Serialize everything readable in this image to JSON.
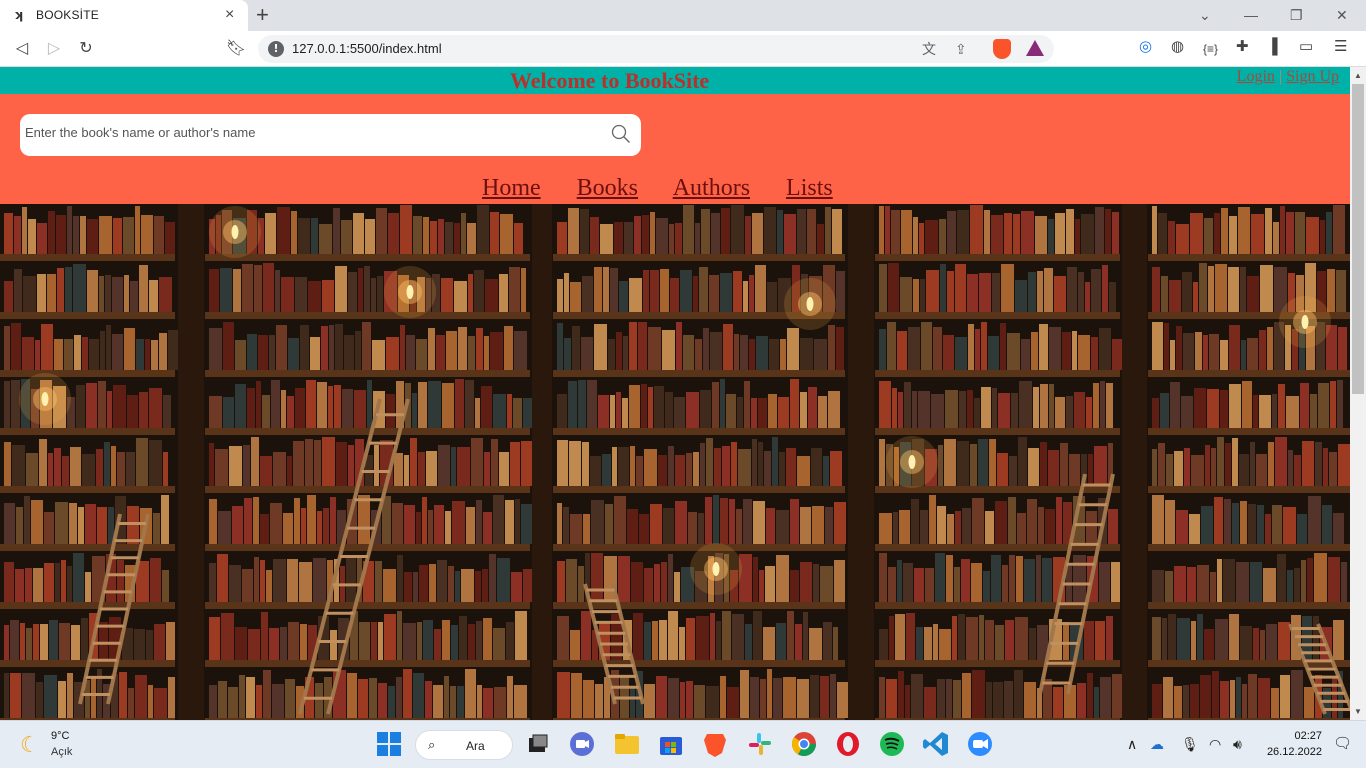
{
  "browser": {
    "tab_title": "BOOKSİTE",
    "tab_close": "×",
    "new_tab": "+",
    "url": "127.0.0.1:5500/index.html"
  },
  "site": {
    "title": "Welcome to BookSite",
    "login": "Login",
    "separator": "|",
    "signup": "Sign Up",
    "search_placeholder": "Enter the book's name or author's name",
    "nav": [
      "Home",
      "Books",
      "Authors",
      "Lists"
    ]
  },
  "taskbar": {
    "weather_temp": "9°C",
    "weather_cond": "Açık",
    "search_label": "Ara",
    "time": "02:27",
    "date": "26.12.2022",
    "apps": [
      "windows-start",
      "file-explorer-dark",
      "zoom-meet",
      "file-explorer",
      "microsoft-store",
      "brave",
      "slack",
      "chrome",
      "opera",
      "spotify",
      "vscode",
      "zoom"
    ]
  },
  "colors": {
    "topstrip": "#00b1a8",
    "header": "#ff6347",
    "title_red": "#b8322b",
    "nav_link": "#6b1010"
  }
}
